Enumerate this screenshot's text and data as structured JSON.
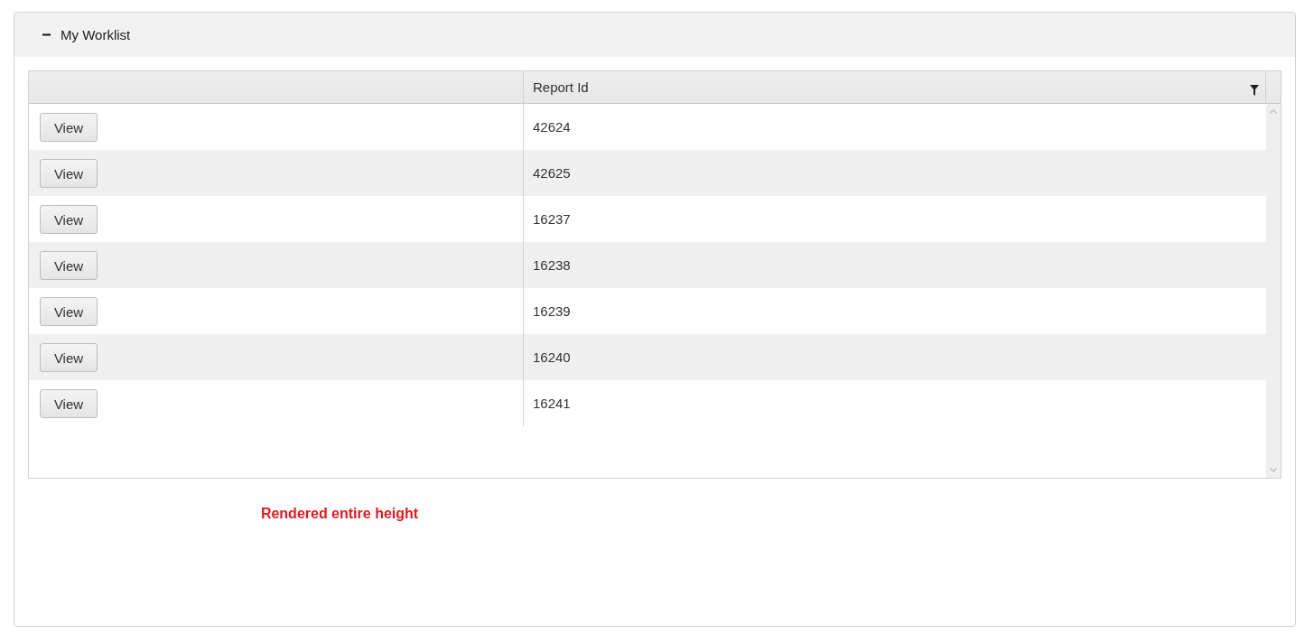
{
  "panel": {
    "title": "My Worklist",
    "expanded": true
  },
  "grid": {
    "columns": [
      {
        "kind": "button"
      },
      {
        "kind": "text",
        "heading": "Report Id",
        "filterable": true
      }
    ],
    "rows": [
      [
        "View",
        "42624"
      ],
      [
        "View",
        "42625"
      ],
      [
        "View",
        "16237"
      ],
      [
        "View",
        "16238"
      ],
      [
        "View",
        "16239"
      ],
      [
        "View",
        "16240"
      ],
      [
        "View",
        "16241"
      ]
    ]
  },
  "note": "Rendered entire height"
}
